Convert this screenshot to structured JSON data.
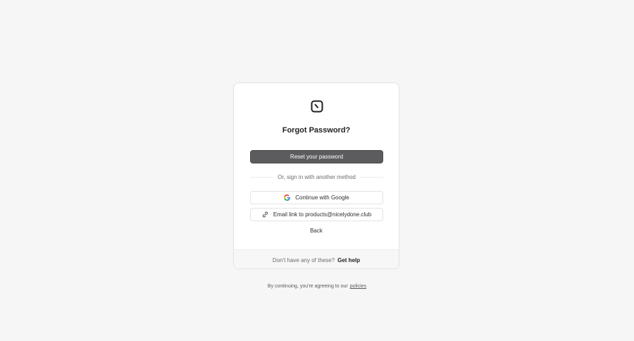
{
  "card": {
    "logo_icon": "clock-square-icon",
    "title": "Forgot Password?",
    "reset_button": "Reset your password",
    "divider_text": "Or, sign in with another method",
    "google_button": "Continue with Google",
    "google_icon": "google-icon",
    "email_button": "Email link to products@nicelydone.club",
    "email_icon": "link-icon",
    "back": "Back"
  },
  "footer": {
    "prompt": "Don't have any of these?",
    "help_link": "Get help"
  },
  "legal": {
    "text": "By continuing, you're agreeing to our",
    "link": "policies"
  }
}
